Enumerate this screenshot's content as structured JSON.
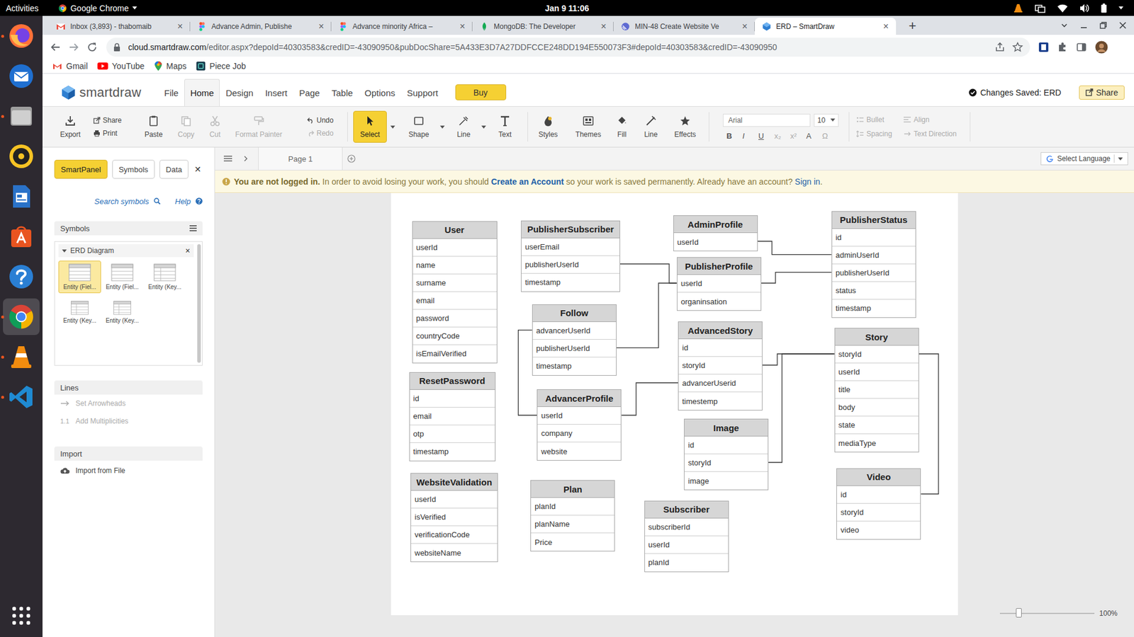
{
  "topbar": {
    "activities": "Activities",
    "app": "Google Chrome",
    "clock": "Jan 9  11:06"
  },
  "dock": [
    {
      "kind": "firefox",
      "running": true,
      "focused": false
    },
    {
      "kind": "thunderbird",
      "running": false,
      "focused": false
    },
    {
      "kind": "files",
      "running": true,
      "focused": false
    },
    {
      "kind": "rhythmbox",
      "running": false,
      "focused": false
    },
    {
      "kind": "writer",
      "running": false,
      "focused": false
    },
    {
      "kind": "software",
      "running": false,
      "focused": false
    },
    {
      "kind": "help",
      "running": false,
      "focused": false
    },
    {
      "kind": "chrome",
      "running": true,
      "focused": true
    },
    {
      "kind": "vlc",
      "running": true,
      "focused": false
    },
    {
      "kind": "vscode",
      "running": true,
      "focused": false
    }
  ],
  "browser": {
    "tabs": [
      {
        "title": "Inbox (3,893) - thabomaib",
        "kind": "gmail",
        "selected": false
      },
      {
        "title": "Advance Admin, Publishe",
        "kind": "figma",
        "selected": false
      },
      {
        "title": "Advance minority Africa –",
        "kind": "figma",
        "selected": false
      },
      {
        "title": "MongoDB: The Developer",
        "kind": "mongodb",
        "selected": false
      },
      {
        "title": "MIN-48 Create Website Ve",
        "kind": "linear",
        "selected": false
      },
      {
        "title": "ERD – SmartDraw",
        "kind": "smartdraw",
        "selected": true
      }
    ],
    "tabClose": "×",
    "newTab": "+",
    "url": {
      "host": "cloud.smartdraw.com",
      "path": "/editor.aspx?depoId=40303583&credID=-43090950&pubDocShare=5A433E3D7A27DDFCCE248DD194E550073F3#depoId=40303583&credID=-43090950"
    },
    "bookmarks": [
      {
        "label": "Gmail",
        "kind": "gmail"
      },
      {
        "label": "YouTube",
        "kind": "youtube"
      },
      {
        "label": "Maps",
        "kind": "maps"
      },
      {
        "label": "Piece Job",
        "kind": "piecejob"
      }
    ]
  },
  "app": {
    "logo": "smartdraw",
    "menu": [
      {
        "label": "File",
        "selected": false
      },
      {
        "label": "Home",
        "selected": true
      },
      {
        "label": "Design",
        "selected": false
      },
      {
        "label": "Insert",
        "selected": false
      },
      {
        "label": "Page",
        "selected": false
      },
      {
        "label": "Table",
        "selected": false
      },
      {
        "label": "Options",
        "selected": false
      },
      {
        "label": "Support",
        "selected": false
      }
    ],
    "buy": "Buy",
    "saved": "Changes Saved: ERD",
    "share": "Share"
  },
  "ribbon": {
    "export": "Export",
    "share": "Share",
    "print": "Print",
    "clipboard": [
      {
        "label": "Paste",
        "disabled": false
      },
      {
        "label": "Copy",
        "disabled": true
      },
      {
        "label": "Cut",
        "disabled": true
      },
      {
        "label": "Format Painter",
        "disabled": true
      }
    ],
    "undo": {
      "label": "Undo",
      "disabled": false
    },
    "redo": {
      "label": "Redo",
      "disabled": true
    },
    "tools": [
      {
        "label": "Select",
        "selected": true,
        "dropdown": true
      },
      {
        "label": "Shape",
        "selected": false,
        "dropdown": true
      },
      {
        "label": "Line",
        "selected": false,
        "dropdown": true
      },
      {
        "label": "Text",
        "selected": false,
        "dropdown": false
      }
    ],
    "format": [
      "Styles",
      "Themes",
      "Fill",
      "Line",
      "Effects"
    ],
    "font": {
      "family": "Arial",
      "size": "10"
    },
    "textButtons": [
      {
        "label": "B",
        "disabled": false
      },
      {
        "label": "I",
        "disabled": false
      },
      {
        "label": "U",
        "disabled": false
      },
      {
        "label": "x₂",
        "disabled": true
      },
      {
        "label": "x²",
        "disabled": true
      },
      {
        "label": "A",
        "disabled": false
      },
      {
        "label": "Ω",
        "disabled": true
      }
    ],
    "paragraph": [
      {
        "label": "Bullet",
        "disabled": true
      },
      {
        "label": "Align",
        "disabled": true
      },
      {
        "label": "Spacing",
        "disabled": true
      },
      {
        "label": "Text Direction",
        "disabled": true
      }
    ]
  },
  "panel": {
    "tabs": [
      {
        "label": "SmartPanel",
        "selected": true
      },
      {
        "label": "Symbols",
        "selected": false
      },
      {
        "label": "Data",
        "selected": false
      }
    ],
    "close": "✕",
    "search": "Search symbols",
    "help": "Help",
    "symbols": {
      "title": "Symbols",
      "library": "ERD Diagram",
      "expanded": true,
      "libraryClose": "×",
      "items": [
        {
          "label": "Entity (Fiel...",
          "selected": true
        },
        {
          "label": "Entity (Fiel...",
          "selected": false
        },
        {
          "label": "Entity (Key...",
          "selected": false
        },
        {
          "label": "Entity (Key...",
          "selected": false
        },
        {
          "label": "Entity (Key...",
          "selected": false
        }
      ]
    },
    "lines": {
      "title": "Lines",
      "items": [
        {
          "label": "Set Arrowheads",
          "kind": "arrow",
          "badge": "",
          "disabled": true
        },
        {
          "label": "Add Multiplicities",
          "kind": "badge",
          "badge": "1.1",
          "disabled": true
        }
      ]
    },
    "import": {
      "title": "Import",
      "items": [
        "Import from File"
      ]
    }
  },
  "canvas": {
    "page": "Page 1",
    "language": "Select Language",
    "notice": {
      "bold": "You are not logged in.",
      "text1": " In order to avoid losing your work, you should ",
      "link1": "Create an Account",
      "text2": " so your work is saved permanently. Already have an account? ",
      "link2": "Sign in",
      "end": "."
    },
    "zoom": {
      "level": 0.2,
      "reading": "100%"
    },
    "entities": [
      {
        "name": "User",
        "fields": [
          "userId",
          "name",
          "surname",
          "email",
          "password",
          "countryCode",
          "isEmailVerified"
        ]
      },
      {
        "name": "PublisherSubscriber",
        "fields": [
          "userEmail",
          "publisherUserId",
          "timestamp"
        ]
      },
      {
        "name": "AdminProfile",
        "fields": [
          "userId"
        ]
      },
      {
        "name": "PublisherProfile",
        "fields": [
          "userId",
          "organinsation"
        ]
      },
      {
        "name": "PublisherStatus",
        "fields": [
          "id",
          "adminUserId",
          "publisherUserId",
          "status",
          "timestamp"
        ]
      },
      {
        "name": "Follow",
        "fields": [
          "advancerUserId",
          "publisherUserId",
          "timestamp"
        ]
      },
      {
        "name": "AdvancedStory",
        "fields": [
          "id",
          "storyId",
          "advancerUserid",
          "timestemp"
        ]
      },
      {
        "name": "Story",
        "fields": [
          "storyId",
          "userId",
          "title",
          "body",
          "state",
          "mediaType"
        ]
      },
      {
        "name": "ResetPassword",
        "fields": [
          "id",
          "email",
          "otp",
          "timestamp"
        ]
      },
      {
        "name": "AdvancerProfile",
        "fields": [
          "userId",
          "company",
          "website"
        ]
      },
      {
        "name": "Image",
        "fields": [
          "id",
          "storyId",
          "image"
        ]
      },
      {
        "name": "Video",
        "fields": [
          "id",
          "storyId",
          "video"
        ]
      },
      {
        "name": "WebsiteValidation",
        "fields": [
          "userId",
          "isVerified",
          "verificationCode",
          "websiteName"
        ]
      },
      {
        "name": "Plan",
        "fields": [
          "planId",
          "planName",
          "Price"
        ]
      },
      {
        "name": "Subscriber",
        "fields": [
          "subscriberId",
          "userId",
          "planId"
        ]
      }
    ]
  }
}
